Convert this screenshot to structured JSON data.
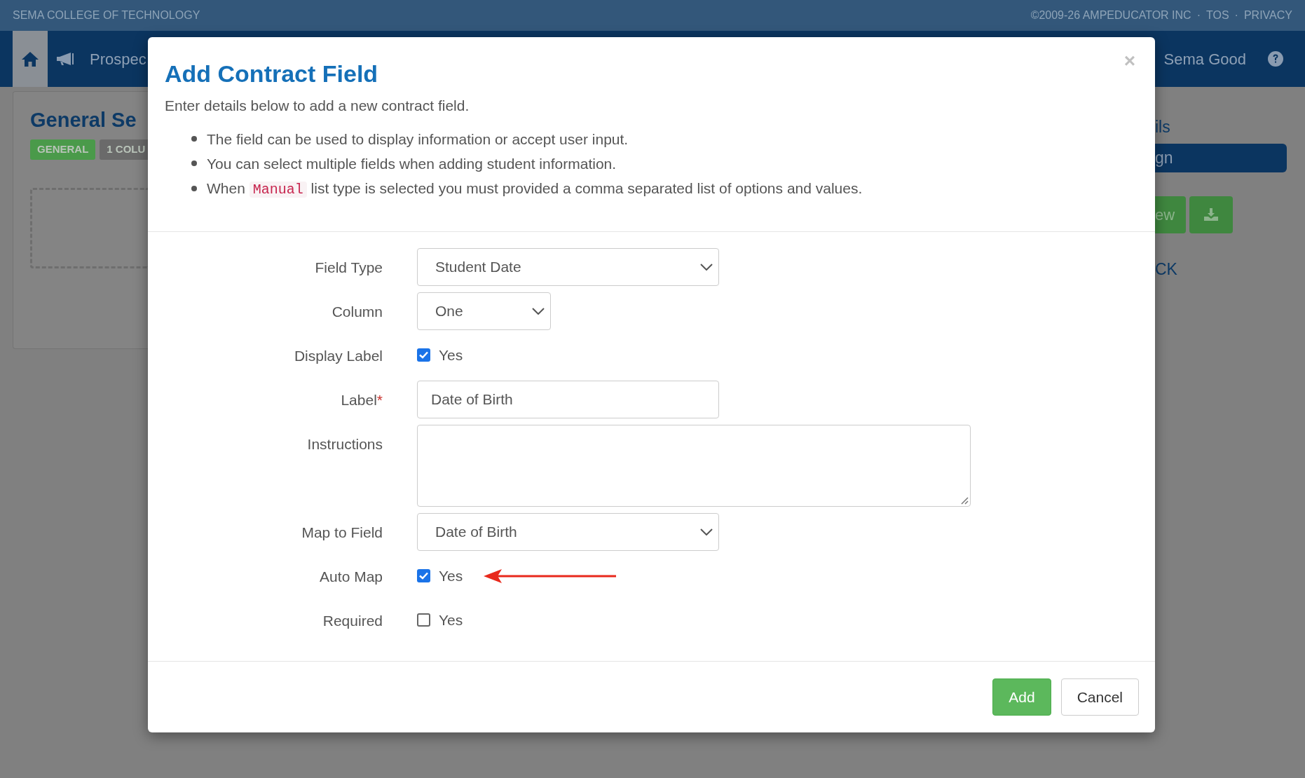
{
  "top_bar": {
    "school": "SEMA COLLEGE OF TECHNOLOGY",
    "copyright": "©2009-26 AMPEDUCATOR INC",
    "separator": "·",
    "links": [
      "TOS",
      "PRIVACY"
    ]
  },
  "nav": {
    "items": [
      {
        "kind": "home",
        "selected": true
      },
      {
        "kind": "megaphone",
        "selected": false
      },
      {
        "kind": "text",
        "label": "Prospec",
        "selected": false
      }
    ],
    "user": "Sema Good"
  },
  "page": {
    "title": "General Se",
    "badges": [
      {
        "label": "GENERAL",
        "color": "#4a9a4a"
      },
      {
        "label": "1 COLU",
        "color": "#6a6a6a"
      }
    ]
  },
  "side_panel": {
    "heading": "ils",
    "bar": "gn",
    "button": "ew",
    "link": "CK"
  },
  "modal": {
    "title": "Add Contract Field",
    "close": "×",
    "intro": "Enter details below to add a new contract field.",
    "bullets": [
      [
        {
          "kind": "text",
          "text": "The field can be used to display information or accept user input."
        }
      ],
      [
        {
          "kind": "text",
          "text": "You can select multiple fields when adding student information."
        }
      ],
      [
        {
          "kind": "text",
          "text": "When "
        },
        {
          "kind": "code",
          "text": "Manual"
        },
        {
          "kind": "text",
          "text": " list type is selected you must provided a comma separated list of options and values."
        }
      ]
    ],
    "fields": [
      {
        "kind": "select",
        "label": "Field Type",
        "value": "Student Date"
      },
      {
        "kind": "short_select",
        "label": "Column",
        "value": "One"
      },
      {
        "kind": "checkbox",
        "label": "Display Label",
        "option": "Yes",
        "checked": true
      },
      {
        "kind": "input",
        "label": "Label",
        "required_mark": "*",
        "value": "Date of Birth"
      },
      {
        "kind": "textarea",
        "label": "Instructions"
      },
      {
        "kind": "select",
        "label": "Map to Field",
        "value": "Date of Birth"
      },
      {
        "kind": "checkbox",
        "label": "Auto Map",
        "option": "Yes",
        "checked": true,
        "annotated": true
      },
      {
        "kind": "checkbox",
        "label": "Required",
        "option": "Yes",
        "checked": false
      }
    ],
    "buttons": [
      {
        "label": "Add",
        "kind": "primary"
      },
      {
        "label": "Cancel",
        "kind": "default"
      }
    ]
  }
}
